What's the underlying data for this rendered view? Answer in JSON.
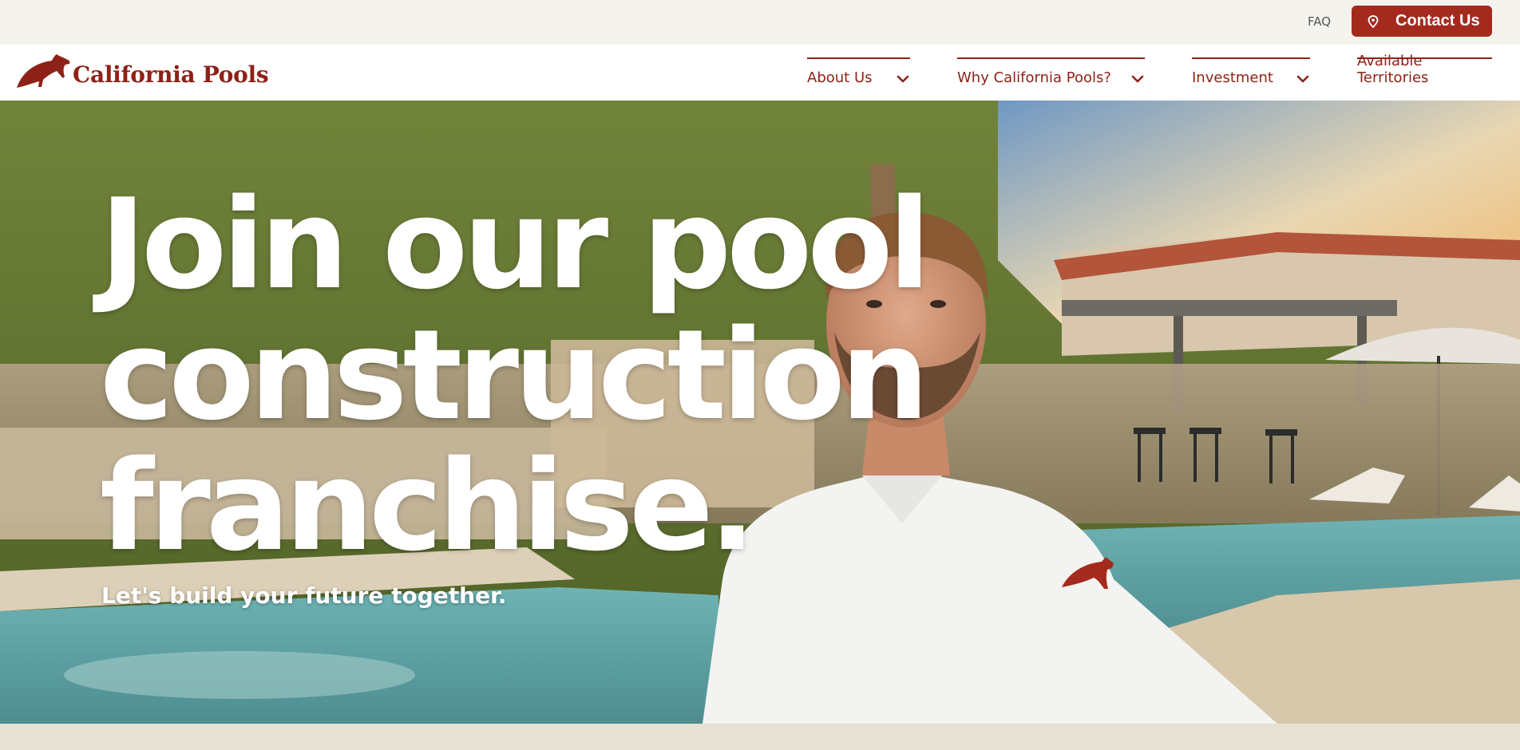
{
  "topbar": {
    "faq_label": "FAQ",
    "contact_label": "Contact Us"
  },
  "brand": {
    "name": "California Pools",
    "color": "#8e2218",
    "button_color": "#a42a1e"
  },
  "nav": {
    "items": [
      {
        "label": "About Us",
        "has_dropdown": true
      },
      {
        "label": "Why California Pools?",
        "has_dropdown": true
      },
      {
        "label": "Investment",
        "has_dropdown": true
      },
      {
        "label": "Available Territories",
        "has_dropdown": false
      }
    ]
  },
  "hero": {
    "title_lines": [
      "Join our pool",
      "construction",
      "franchise."
    ],
    "subtitle": "Let's build your future together."
  },
  "icons": {
    "contact": "location-pin-icon",
    "dropdown": "chevron-down-icon",
    "logo": "bear-logo-icon"
  }
}
